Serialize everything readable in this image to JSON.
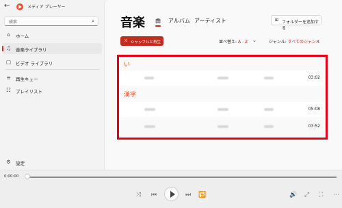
{
  "app": {
    "title": "メディア プレーヤー",
    "back_icon": "back-arrow-icon",
    "logo_color": "#e8542c"
  },
  "window_controls": [
    "minimize-icon",
    "maximize-icon",
    "close-icon"
  ],
  "search": {
    "placeholder": "検索"
  },
  "nav": {
    "items": [
      {
        "label": "ホーム",
        "icon": "home-icon"
      },
      {
        "label": "音楽ライブラリ",
        "icon": "music-note-icon",
        "active": true
      },
      {
        "label": "ビデオ ライブラリ",
        "icon": "video-icon"
      },
      {
        "label": "再生キュー",
        "icon": "queue-icon"
      },
      {
        "label": "プレイリスト",
        "icon": "playlist-icon"
      }
    ],
    "settings_label": "設定"
  },
  "header": {
    "title": "音楽",
    "tabs": [
      {
        "label": "曲",
        "active": true
      },
      {
        "label": "アルバム"
      },
      {
        "label": "アーティスト"
      }
    ],
    "add_folder_label": "フォルダーを追加する"
  },
  "toolbar": {
    "shuffle_label": "シャッフルと再生",
    "sort_label": "並べ替え:",
    "sort_value": "A - Z",
    "genre_label": "ジャンル:",
    "genre_value": "すべてのジャンル"
  },
  "songs": {
    "groups": [
      {
        "letter": "い",
        "rows": [
          {
            "duration": "03:02"
          }
        ]
      },
      {
        "letter": "漢字",
        "rows": [
          {
            "duration": "05:08"
          },
          {
            "duration": "03:52"
          }
        ]
      }
    ]
  },
  "player": {
    "current_time": "0:00:00"
  },
  "colors": {
    "accent": "#c42b1c",
    "highlight_box": "#e60012"
  }
}
